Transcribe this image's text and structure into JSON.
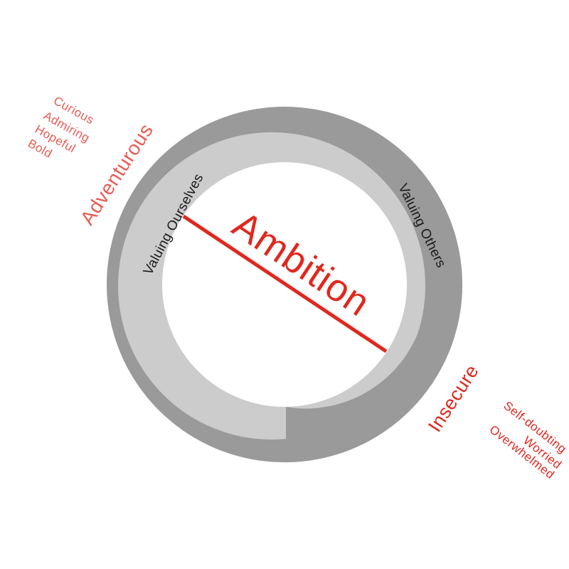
{
  "diagram": {
    "center_label": "Ambition",
    "inner_labels": {
      "left": "Valuing Ourselves",
      "right": "Valuing Others"
    },
    "positive": {
      "main": "Adventurous",
      "items": [
        "Curious",
        "Admiring",
        "Hopeful",
        "Bold"
      ]
    },
    "negative": {
      "main": "Insecure",
      "items": [
        "Self-doubting",
        "Worried",
        "Overwhelmed"
      ]
    },
    "colors": {
      "outer_ring": "#9a9a9a",
      "inner_ring": "#cccccc",
      "center": "#ffffff",
      "accent": "#e0281e",
      "positive_text": "#ea5a52",
      "label_text": "#1a1a1a"
    }
  }
}
